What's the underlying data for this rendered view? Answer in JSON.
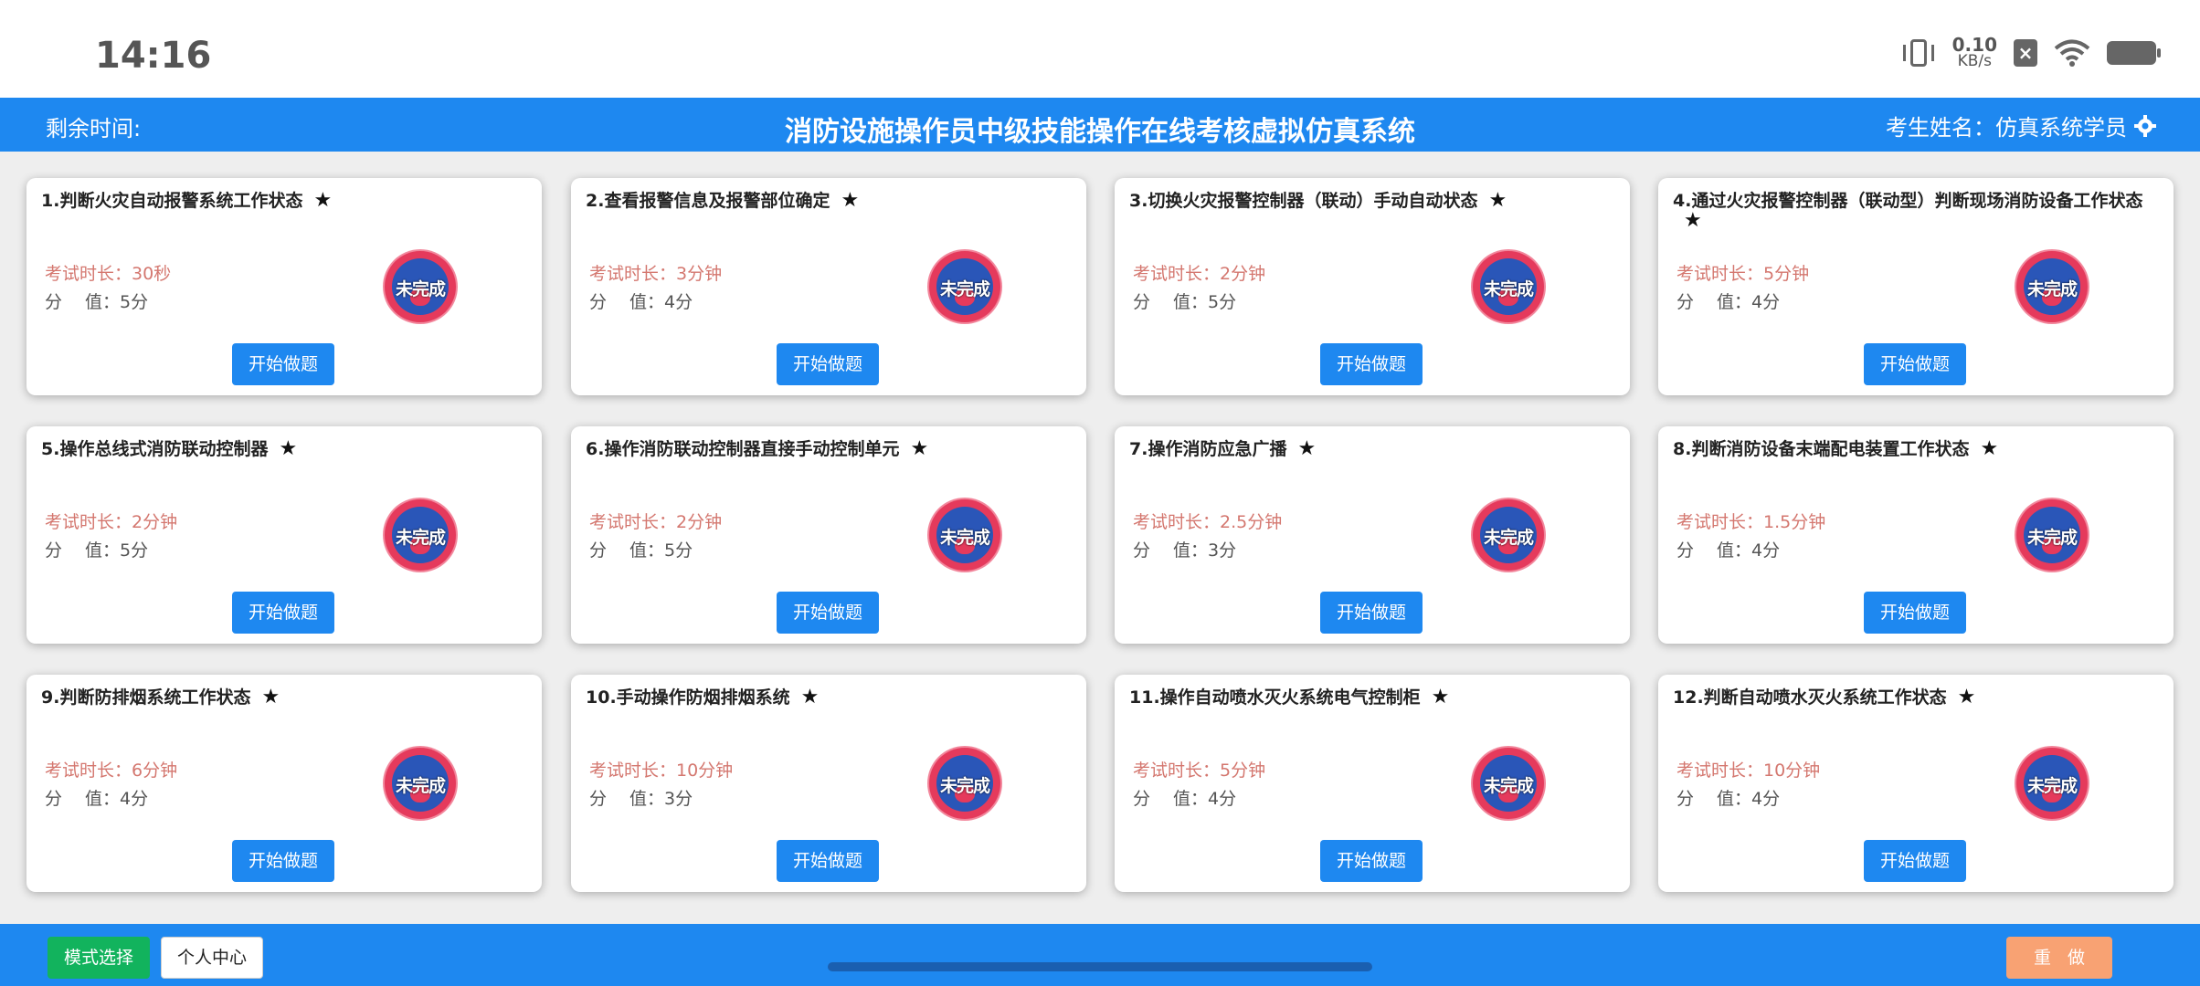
{
  "status_bar": {
    "time": "14:16",
    "network_speed_value": "0.10",
    "network_speed_unit": "KB/s",
    "sim_status": "×"
  },
  "header": {
    "remaining_time_label": "剩余时间:",
    "title": "消防设施操作员中级技能操作在线考核虚拟仿真系统",
    "examinee": "考生姓名：仿真系统学员"
  },
  "badge_text": "未完成",
  "start_label": "开始做题",
  "cards": [
    {
      "title": "1.判断火灾自动报警系统工作状态",
      "duration": "考试时长：30秒",
      "score": "分　 值：5分"
    },
    {
      "title": "2.查看报警信息及报警部位确定",
      "duration": "考试时长：3分钟",
      "score": "分　 值：4分"
    },
    {
      "title": "3.切换火灾报警控制器（联动）手动自动状态",
      "duration": "考试时长：2分钟",
      "score": "分　 值：5分"
    },
    {
      "title": "4.通过火灾报警控制器（联动型）判断现场消防设备工作状态",
      "duration": "考试时长：5分钟",
      "score": "分　 值：4分"
    },
    {
      "title": "5.操作总线式消防联动控制器",
      "duration": "考试时长：2分钟",
      "score": "分　 值：5分"
    },
    {
      "title": "6.操作消防联动控制器直接手动控制单元",
      "duration": "考试时长：2分钟",
      "score": "分　 值：5分"
    },
    {
      "title": "7.操作消防应急广播",
      "duration": "考试时长：2.5分钟",
      "score": "分　 值：3分"
    },
    {
      "title": "8.判断消防设备末端配电装置工作状态",
      "duration": "考试时长：1.5分钟",
      "score": "分　 值：4分"
    },
    {
      "title": "9.判断防排烟系统工作状态",
      "duration": "考试时长：6分钟",
      "score": "分　 值：4分"
    },
    {
      "title": "10.手动操作防烟排烟系统",
      "duration": "考试时长：10分钟",
      "score": "分　 值：3分"
    },
    {
      "title": "11.操作自动喷水灭火系统电气控制柜",
      "duration": "考试时长：5分钟",
      "score": "分　 值：4分"
    },
    {
      "title": "12.判断自动喷水灭火系统工作状态",
      "duration": "考试时长：10分钟",
      "score": "分　 值：4分"
    }
  ],
  "footer": {
    "mode_select": "模式选择",
    "personal_center": "个人中心",
    "redo": "重做"
  },
  "colors": {
    "primary": "#1e88f0",
    "mode_button": "#12b35d",
    "redo_button": "#f8a273",
    "badge": "#e53a5c"
  }
}
